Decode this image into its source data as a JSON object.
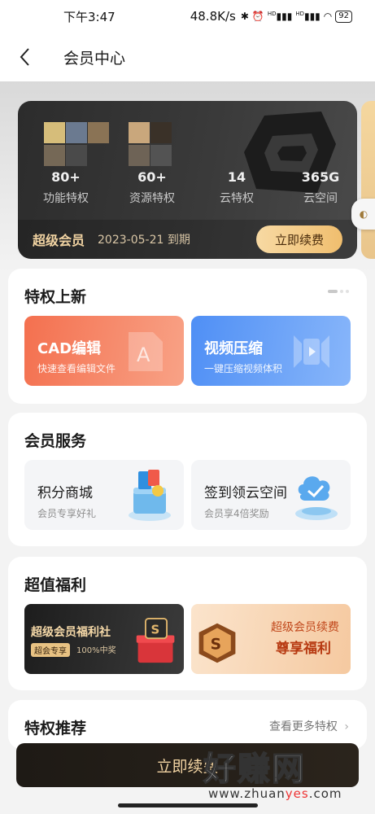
{
  "status_bar": {
    "time": "下午3:47",
    "net_speed": "48.8K/s",
    "icons": [
      "bluetooth-icon",
      "alarm-icon",
      "signal-hd-icon",
      "signal-hd-icon",
      "wifi-icon"
    ],
    "signal_label_1": "HD",
    "signal_label_2": "HD",
    "battery": "92"
  },
  "nav": {
    "title": "会员中心"
  },
  "vip_card": {
    "stats": [
      {
        "value": "80+",
        "label": "功能特权"
      },
      {
        "value": "60+",
        "label": "资源特权"
      },
      {
        "value": "14",
        "label": "云特权"
      },
      {
        "value": "365G",
        "label": "云空间"
      }
    ],
    "level": "超级会员",
    "expire": "2023-05-21 到期",
    "renew_label": "立即续费",
    "colors": {
      "card": "#2c2c2c",
      "gold": "#f1d3a2",
      "button": "#f0be6e"
    }
  },
  "new_privileges": {
    "title": "特权上新",
    "cards": [
      {
        "title": "CAD编辑",
        "subtitle": "快速查看编辑文件",
        "color": "#f4704f",
        "icon": "cad-file-icon"
      },
      {
        "title": "视频压缩",
        "subtitle": "一键压缩视频体积",
        "color": "#4f8ff5",
        "icon": "video-compress-icon"
      }
    ]
  },
  "member_services": {
    "title": "会员服务",
    "cards": [
      {
        "title": "积分商城",
        "subtitle": "会员专享好礼",
        "icon": "points-mall-icon"
      },
      {
        "title": "签到领云空间",
        "subtitle": "会员享4倍奖励",
        "icon": "cloud-checkin-icon"
      }
    ]
  },
  "welfare": {
    "title": "超值福利",
    "dark_card": {
      "title": "超级会员福利社",
      "tag": "超会专享",
      "note": "100%中奖"
    },
    "light_card": {
      "line1": "超级会员续费",
      "line2": "尊享福利"
    }
  },
  "recommend": {
    "title": "特权推荐",
    "more": "查看更多特权"
  },
  "bottom_button": {
    "label": "立即续费"
  },
  "watermark": {
    "big": "好赚网",
    "url_prefix": "www.zhuan",
    "url_highlight": "yes",
    "url_suffix": ".com"
  }
}
